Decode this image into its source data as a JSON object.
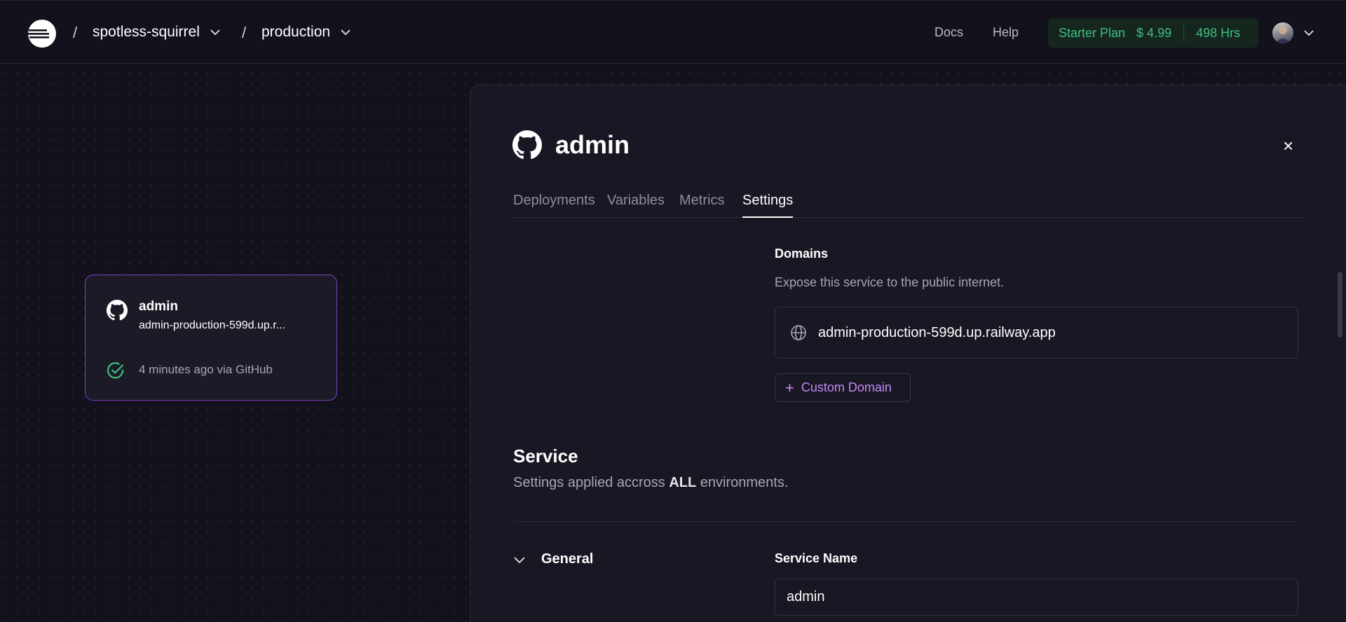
{
  "header": {
    "project": "spotless-squirrel",
    "environment": "production",
    "separator": "/",
    "links": {
      "docs": "Docs",
      "help": "Help"
    },
    "plan": {
      "name": "Starter Plan",
      "price": "$ 4.99",
      "hours": "498 Hrs"
    }
  },
  "canvas": {
    "card": {
      "title": "admin",
      "url": "admin-production-599d.up.r...",
      "status": "4 minutes ago via GitHub"
    }
  },
  "panel": {
    "title": "admin",
    "close": "×",
    "tabs": [
      "Deployments",
      "Variables",
      "Metrics",
      "Settings"
    ],
    "active_tab": "Settings",
    "domains": {
      "heading": "Domains",
      "description": "Expose this service to the public internet.",
      "domain": "admin-production-599d.up.railway.app",
      "custom_button": "Custom Domain",
      "custom_button_icon": "+"
    },
    "service": {
      "heading": "Service",
      "description_prefix": "Settings applied accross ",
      "description_bold": "ALL",
      "description_suffix": " environments.",
      "general_label": "General",
      "service_name_label": "Service Name",
      "service_name_value": "admin"
    }
  },
  "colors": {
    "background": "#13111c",
    "panel": "#191723",
    "accent_purple": "#c58af9",
    "card_border": "#7a3fc0",
    "plan_green": "#3fbf7f",
    "check_green": "#3fbf7f"
  },
  "icons": [
    "railway-logo-icon",
    "chevron-down-icon",
    "github-icon",
    "check-circle-icon",
    "globe-icon",
    "plus-icon",
    "close-icon"
  ]
}
